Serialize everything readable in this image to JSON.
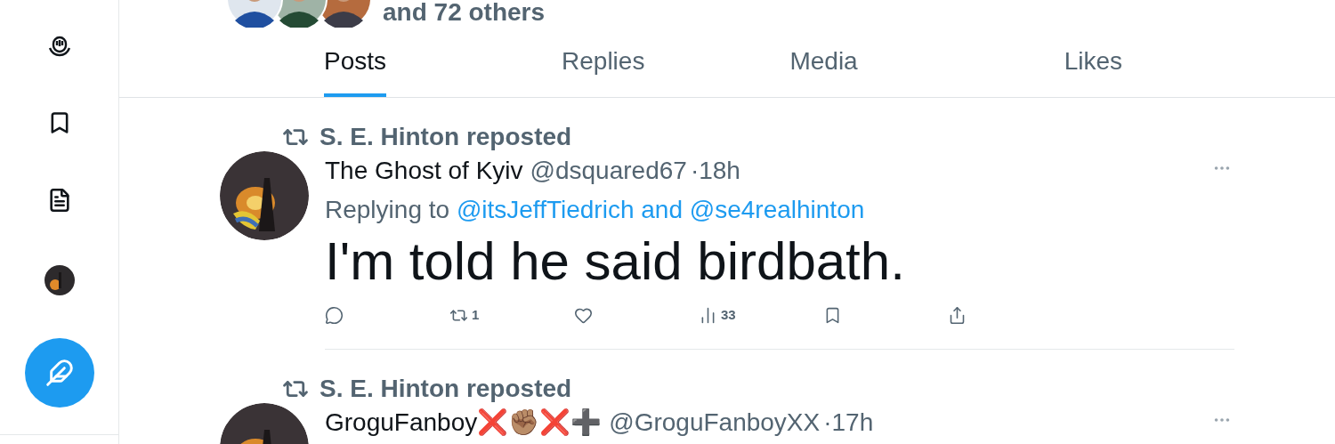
{
  "sidebar": {
    "items": [
      {
        "kind": "spaces"
      },
      {
        "kind": "bookmarks"
      },
      {
        "kind": "lists"
      },
      {
        "kind": "profile"
      }
    ]
  },
  "followers": {
    "text": "and 72 others"
  },
  "tabs": [
    {
      "label": "Posts",
      "selected": true
    },
    {
      "label": "Replies",
      "selected": false
    },
    {
      "label": "Media",
      "selected": false
    },
    {
      "label": "Likes",
      "selected": false
    }
  ],
  "posts": [
    {
      "repost_label": "S. E. Hinton reposted",
      "name": "The Ghost of Kyiv",
      "handle": "@dsquared67",
      "separator": "·",
      "time": "18h",
      "replying_prefix": "Replying to",
      "replying_to": "@itsJeffTiedrich and @se4realhinton",
      "text": "I'm told he said birdbath.",
      "actions": [
        {
          "kind": "reply"
        },
        {
          "kind": "repost",
          "count": "1"
        },
        {
          "kind": "like"
        },
        {
          "kind": "views",
          "count": "33"
        },
        {
          "kind": "bookmark"
        },
        {
          "kind": "share"
        }
      ]
    },
    {
      "repost_label": "S. E. Hinton reposted",
      "name": "GroguFanboy❌✊🏽❌➕",
      "handle": "@GroguFanboyXX",
      "separator": "·",
      "time": "17h"
    }
  ]
}
